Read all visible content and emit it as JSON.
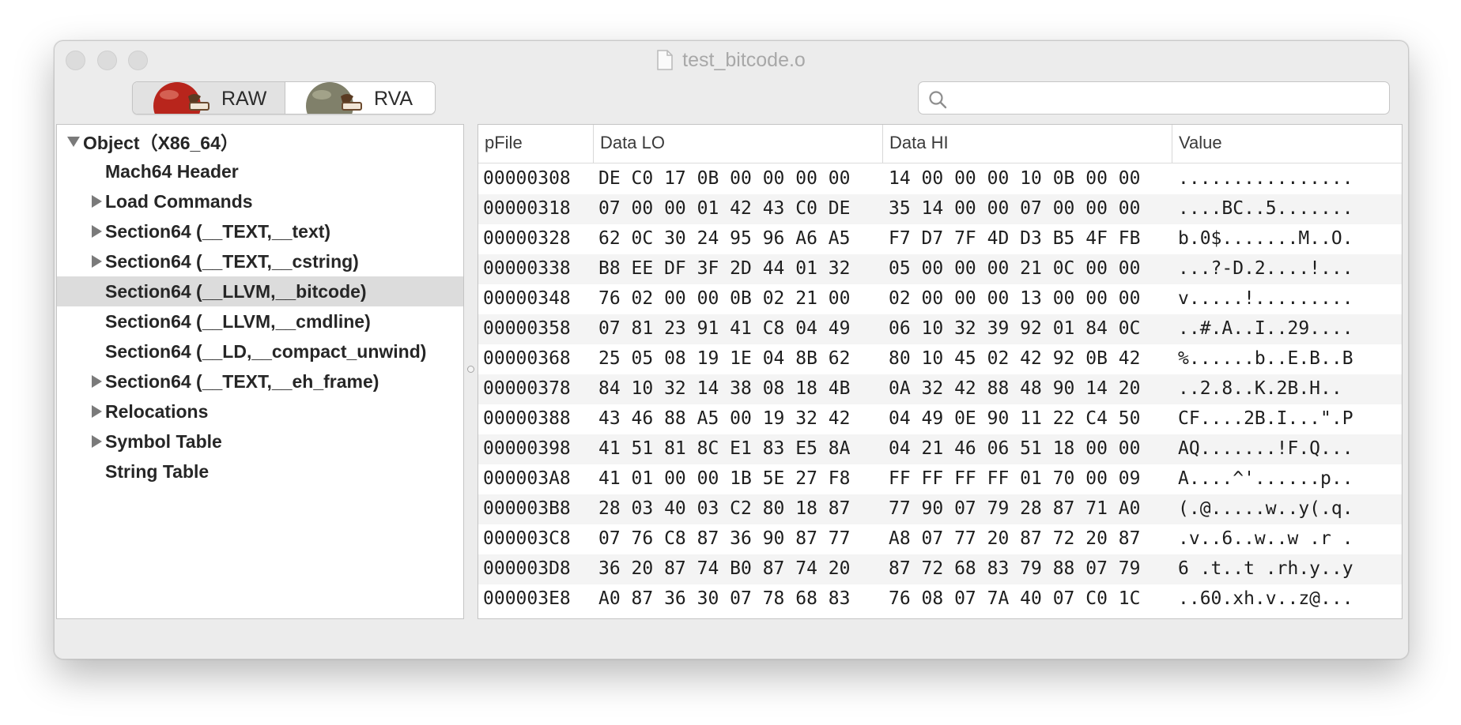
{
  "window": {
    "title": "test_bitcode.o"
  },
  "toolbar": {
    "segments": [
      {
        "label": "RAW",
        "selected": true
      },
      {
        "label": "RVA",
        "selected": false
      }
    ],
    "search": {
      "value": "",
      "placeholder": ""
    }
  },
  "tree": {
    "items": [
      {
        "label": "Object（X86_64）",
        "expander": "expanded"
      },
      {
        "label": "Mach64 Header",
        "expander": "none"
      },
      {
        "label": "Load Commands",
        "expander": "collapsed"
      },
      {
        "label": "Section64 (__TEXT,__text)",
        "expander": "collapsed"
      },
      {
        "label": "Section64 (__TEXT,__cstring)",
        "expander": "collapsed"
      },
      {
        "label": "Section64 (__LLVM,__bitcode)",
        "expander": "none",
        "selected": true
      },
      {
        "label": "Section64 (__LLVM,__cmdline)",
        "expander": "none"
      },
      {
        "label": "Section64 (__LD,__compact_unwind)",
        "expander": "none"
      },
      {
        "label": "Section64 (__TEXT,__eh_frame)",
        "expander": "collapsed"
      },
      {
        "label": "Relocations",
        "expander": "collapsed"
      },
      {
        "label": "Symbol Table",
        "expander": "collapsed"
      },
      {
        "label": "String Table",
        "expander": "none"
      }
    ]
  },
  "table": {
    "columns": [
      "pFile",
      "Data LO",
      "Data HI",
      "Value"
    ],
    "rows": [
      {
        "pfile": "00000308",
        "lo": "DE C0 17 0B 00 00 00 00",
        "hi": "14 00 00 00 10 0B 00 00",
        "value": "................"
      },
      {
        "pfile": "00000318",
        "lo": "07 00 00 01 42 43 C0 DE",
        "hi": "35 14 00 00 07 00 00 00",
        "value": "....BC..5......."
      },
      {
        "pfile": "00000328",
        "lo": "62 0C 30 24 95 96 A6 A5",
        "hi": "F7 D7 7F 4D D3 B5 4F FB",
        "value": "b.0$.......M..O."
      },
      {
        "pfile": "00000338",
        "lo": "B8 EE DF 3F 2D 44 01 32",
        "hi": "05 00 00 00 21 0C 00 00",
        "value": "...?-D.2....!..."
      },
      {
        "pfile": "00000348",
        "lo": "76 02 00 00 0B 02 21 00",
        "hi": "02 00 00 00 13 00 00 00",
        "value": "v.....!........."
      },
      {
        "pfile": "00000358",
        "lo": "07 81 23 91 41 C8 04 49",
        "hi": "06 10 32 39 92 01 84 0C",
        "value": "..#.A..I..29...."
      },
      {
        "pfile": "00000368",
        "lo": "25 05 08 19 1E 04 8B 62",
        "hi": "80 10 45 02 42 92 0B 42",
        "value": "%......b..E.B..B"
      },
      {
        "pfile": "00000378",
        "lo": "84 10 32 14 38 08 18 4B",
        "hi": "0A 32 42 88 48 90 14 20",
        "value": "..2.8..K.2B.H.. "
      },
      {
        "pfile": "00000388",
        "lo": "43 46 88 A5 00 19 32 42",
        "hi": "04 49 0E 90 11 22 C4 50",
        "value": "CF....2B.I...\".P"
      },
      {
        "pfile": "00000398",
        "lo": "41 51 81 8C E1 83 E5 8A",
        "hi": "04 21 46 06 51 18 00 00",
        "value": "AQ.......!F.Q..."
      },
      {
        "pfile": "000003A8",
        "lo": "41 01 00 00 1B 5E 27 F8",
        "hi": "FF FF FF FF 01 70 00 09",
        "value": "A....^'......p.."
      },
      {
        "pfile": "000003B8",
        "lo": "28 03 40 03 C2 80 18 87",
        "hi": "77 90 07 79 28 87 71 A0",
        "value": "(.@.....w..y(.q."
      },
      {
        "pfile": "000003C8",
        "lo": "07 76 C8 87 36 90 87 77",
        "hi": "A8 07 77 20 87 72 20 87",
        "value": ".v..6..w..w .r ."
      },
      {
        "pfile": "000003D8",
        "lo": "36 20 87 74 B0 87 74 20",
        "hi": "87 72 68 83 79 88 07 79",
        "value": "6 .t..t .rh.y..y"
      },
      {
        "pfile": "000003E8",
        "lo": "A0 87 36 30 07 78 68 83",
        "hi": "76 08 07 7A 40 07 C0 1C",
        "value": "..60.xh.v..z@..."
      }
    ]
  }
}
